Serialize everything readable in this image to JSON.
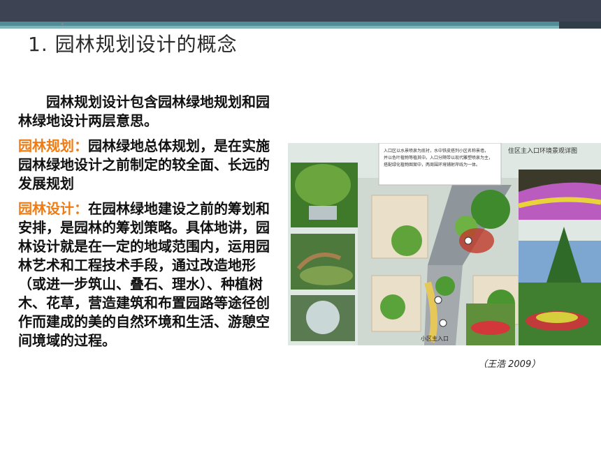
{
  "slide": {
    "title": "1. 园林规划设计的概念",
    "intro": "园林规划设计包含园林绿地规划和园林绿地设计两层意思。",
    "planning_term": "园林规划：",
    "planning_text": "园林绿地总体规划，是在实施园林绿地设计之前制定的较全面、长远的发展规划",
    "design_term": "园林设计：",
    "design_text": "在园林绿地建设之前的筹划和安排，是园林的筹划策略。具体地讲，园林设计就是在一定的地域范围内，运用园林艺术和工程技术手段，通过改造地形（或进一步筑山、叠石、理水）、种植树木、花草，营造建筑和布置园路等途径创作而建成的美的自然环境和生活、游憩空间境域的过程。"
  },
  "figure": {
    "heading": "住区主入口环境景观详图",
    "entrance_label": "小区主入口",
    "note_text": "入口区以水景喷泉为底衬，水中铁皮搭列小区名称景墙，并以色叶植物等植其中。入口分隔带以现代雕塑喷泉为主，搭配绿化植物图案中，两周围环境铺射岸线为一体。",
    "caption": "（王浩 2009）"
  },
  "colors": {
    "accent_orange": "#f07b12",
    "header_dark": "#3d4352",
    "header_teal": "#4f8d97"
  }
}
